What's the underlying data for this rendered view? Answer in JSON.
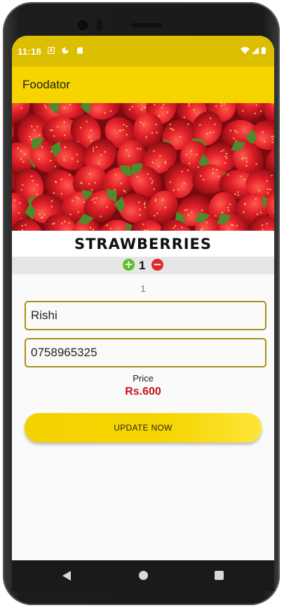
{
  "status": {
    "time": "11:18",
    "icons": [
      "notification-a-icon",
      "notification-b-icon",
      "sd-card-icon",
      "wifi-icon",
      "signal-icon",
      "battery-icon"
    ]
  },
  "app": {
    "title": "Foodator"
  },
  "product": {
    "image": "strawberries-photo",
    "name": "STRAWBERRIES"
  },
  "quantity": {
    "value": "1",
    "display": "1",
    "plus_icon": "plus-circle-icon",
    "minus_icon": "minus-circle-icon"
  },
  "form": {
    "name_value": "Rishi",
    "phone_value": "0758965325"
  },
  "price": {
    "label": "Price",
    "value": "Rs.600"
  },
  "actions": {
    "update_label": "UPDATE NOW"
  },
  "colors": {
    "status_bar": "#dcbf00",
    "app_bar": "#f5d400",
    "price": "#c8121c",
    "plus": "#5bc02a",
    "minus": "#e02a2a",
    "field_border": "#a89018"
  },
  "nav": {
    "icons": [
      "back-icon",
      "home-icon",
      "recent-apps-icon"
    ]
  }
}
